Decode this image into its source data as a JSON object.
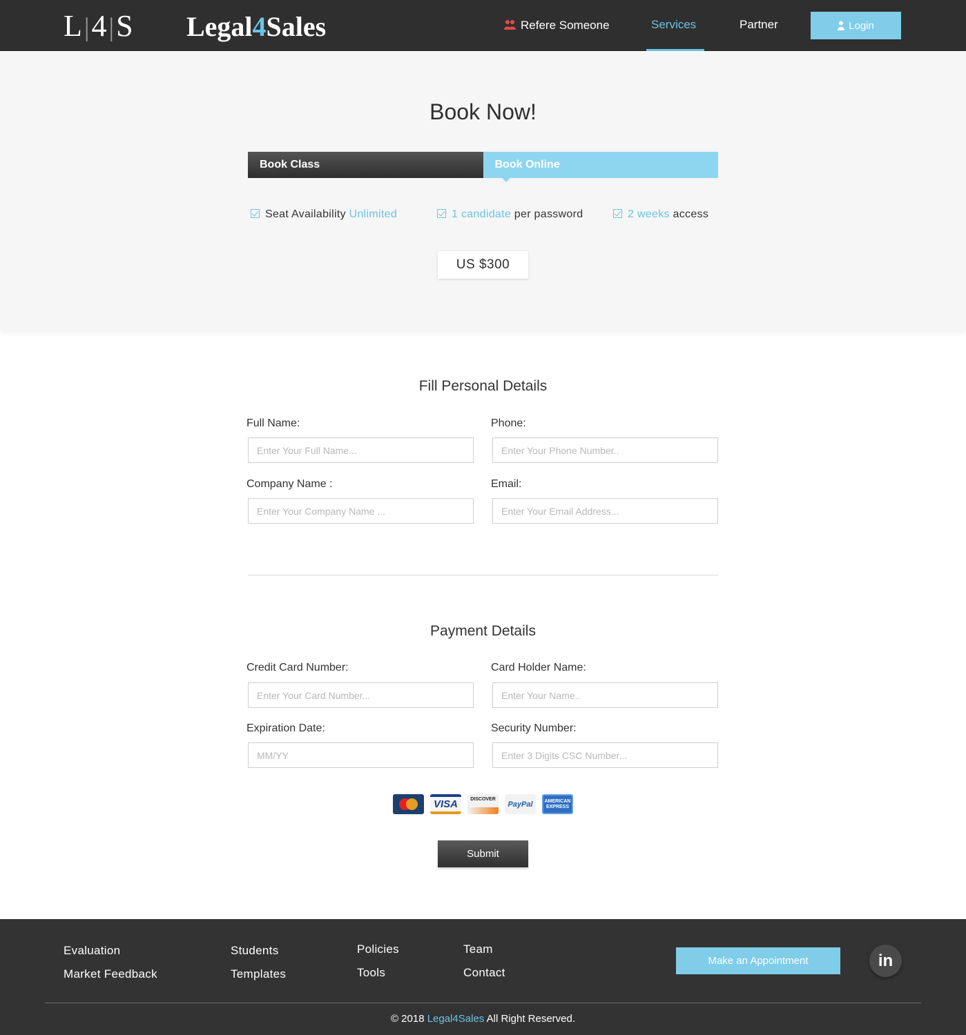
{
  "header": {
    "logo_mark": [
      "L",
      "4",
      "S"
    ],
    "logo_word_prefix": "Legal",
    "logo_word_num": "4",
    "logo_word_suffix": "Sales",
    "nav": {
      "refer": "Refere Someone",
      "services": "Services",
      "partner": "Partner"
    },
    "login_label": "Login",
    "accent_color": "#6cc3e4"
  },
  "booking": {
    "title": "Book Now!",
    "tabs": [
      {
        "label": "Book Class",
        "active": false
      },
      {
        "label": "Book Online",
        "active": true
      }
    ],
    "features": [
      {
        "pre": "Seat Availability ",
        "hl": "Unlimited",
        "post": ""
      },
      {
        "pre": "",
        "hl": "1 candidate",
        "post": " per password"
      },
      {
        "pre": "",
        "hl": "2 weeks",
        "post": " access"
      }
    ],
    "price": "US $300"
  },
  "personal": {
    "title": "Fill Personal Details",
    "full_name": {
      "label": "Full Name:",
      "placeholder": "Enter Your Full Name..."
    },
    "phone": {
      "label": "Phone:",
      "placeholder": "Enter Your Phone Number.."
    },
    "company": {
      "label": "Company Name :",
      "placeholder": "Enter Your Company Name ..."
    },
    "email": {
      "label": "Email:",
      "placeholder": "Enter Your Email Address..."
    }
  },
  "payment": {
    "title": "Payment Details",
    "card_number": {
      "label": "Credit Card Number:",
      "placeholder": "Enter Your Card Number..."
    },
    "holder": {
      "label": "Card Holder Name:",
      "placeholder": "Enter Your Name.."
    },
    "expiry": {
      "label": "Expiration Date:",
      "placeholder": "MM/YY"
    },
    "security": {
      "label": "Security Number:",
      "placeholder": "Enter 3 Digits CSC Number..."
    },
    "card_logos": {
      "mastercard": "MasterCard",
      "visa": "VISA",
      "discover": "DISCOVER",
      "paypal": "PayPal",
      "amex": "AMERICAN EXPRESS"
    },
    "submit_label": "Submit"
  },
  "footer": {
    "links": {
      "evaluation": "Evaluation",
      "market_feedback": "Market Feedback",
      "students": "Students",
      "templates": "Templates",
      "policies": "Policies",
      "tools": "Tools",
      "team": "Team",
      "contact": "Contact"
    },
    "appointment_label": "Make an Appointment",
    "linkedin_label": "in",
    "copyright_pre": "© 2018 ",
    "copyright_brand": "Legal4Sales",
    "copyright_post": " All Right Reserved."
  }
}
